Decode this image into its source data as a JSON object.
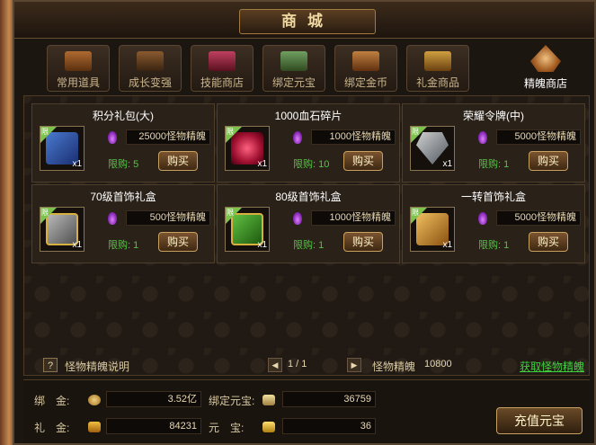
{
  "window": {
    "title": "商城"
  },
  "tabs": [
    {
      "label": "常用道具",
      "icon": "item-bag-icon"
    },
    {
      "label": "成长变强",
      "icon": "growth-icon"
    },
    {
      "label": "技能商店",
      "icon": "skill-book-icon"
    },
    {
      "label": "绑定元宝",
      "icon": "bound-ingot-icon"
    },
    {
      "label": "绑定金币",
      "icon": "bound-gold-icon"
    },
    {
      "label": "礼金商品",
      "icon": "gift-gold-icon"
    },
    {
      "label": "精魄商店",
      "icon": "soul-shop-icon",
      "active": true
    }
  ],
  "items": [
    {
      "name": "积分礼包(大)",
      "qty": "x1",
      "badge": "限",
      "price": "25000怪物精魄",
      "limit": "限购: 5",
      "buy": "购买",
      "icon": "blue-chest-icon"
    },
    {
      "name": "1000血石碎片",
      "qty": "x1",
      "badge": "限",
      "price": "1000怪物精魄",
      "limit": "限购: 10",
      "buy": "购买",
      "icon": "red-crystal-icon"
    },
    {
      "name": "荣耀令牌(中)",
      "qty": "x1",
      "badge": "限",
      "price": "5000怪物精魄",
      "limit": "限购: 1",
      "buy": "购买",
      "icon": "shield-token-icon"
    },
    {
      "name": "70级首饰礼盒",
      "qty": "x1",
      "badge": "限",
      "price": "500怪物精魄",
      "limit": "限购: 1",
      "buy": "购买",
      "icon": "gray-giftbox-icon"
    },
    {
      "name": "80级首饰礼盒",
      "qty": "x1",
      "badge": "限",
      "price": "1000怪物精魄",
      "limit": "限购: 1",
      "buy": "购买",
      "icon": "green-giftbox-icon"
    },
    {
      "name": "一转首饰礼盒",
      "qty": "x1",
      "badge": "限",
      "price": "5000怪物精魄",
      "limit": "限购: 1",
      "buy": "购买",
      "icon": "gold-chest-icon"
    }
  ],
  "footer": {
    "help_icon": "?",
    "help_label": "怪物精魄说明",
    "page": "1 / 1",
    "prev": "◀",
    "next": "▶",
    "soul_label": "怪物精魄",
    "soul_value": "10800",
    "get_link": "获取怪物精魄"
  },
  "currency": {
    "bound_gold_label": "绑　金:",
    "bound_gold_value": "3.52亿",
    "bound_ingot_label": "绑定元宝:",
    "bound_ingot_value": "36759",
    "gift_gold_label": "礼　金:",
    "gift_gold_value": "84231",
    "ingot_label": "元　宝:",
    "ingot_value": "36",
    "recharge": "充值元宝"
  },
  "colors": {
    "limit_green": "#4cc83c",
    "link_green": "#3fd23f",
    "soul_purple": "#b040e0"
  }
}
